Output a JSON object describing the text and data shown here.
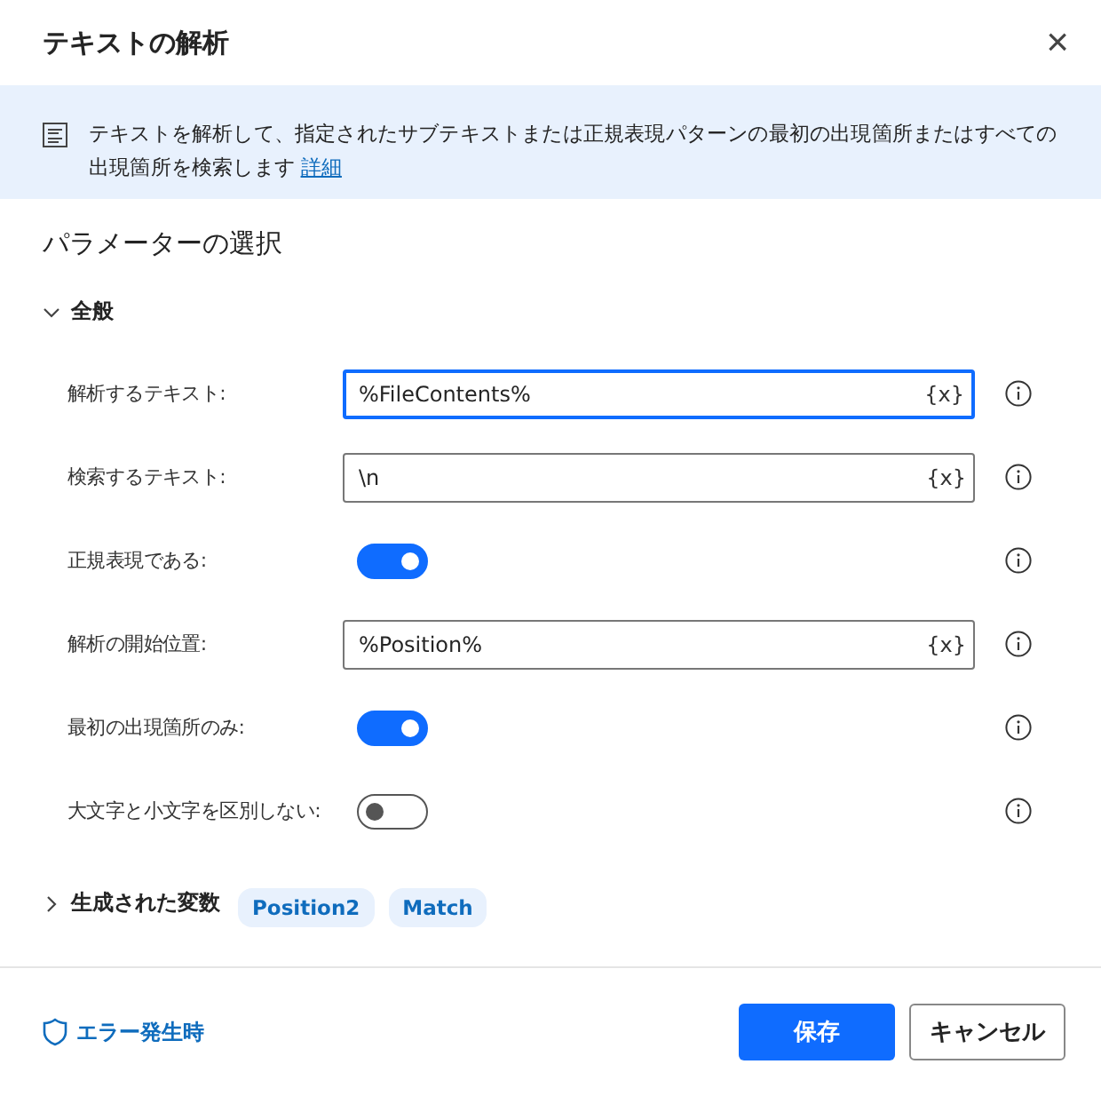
{
  "window": {
    "title": "テキストの解析",
    "close": "×"
  },
  "info": {
    "text": "テキストを解析して、指定されたサブテキストまたは正規表現パターンの最初の出現箇所またはすべての出現箇所を検索します",
    "link": "詳細"
  },
  "section_title": "パラメーターの選択",
  "group": {
    "label": "全般",
    "expanded": true
  },
  "params": [
    {
      "kind": "text",
      "label": "解析するテキスト:",
      "value": "%FileContents%",
      "focused": true,
      "var_button": "{x}"
    },
    {
      "kind": "text",
      "label": "検索するテキスト:",
      "value": "\\n",
      "focused": false,
      "var_button": "{x}"
    },
    {
      "kind": "toggle",
      "label": "正規表現である:",
      "on": true
    },
    {
      "kind": "text",
      "label": "解析の開始位置:",
      "value": "%Position%",
      "focused": false,
      "var_button": "{x}"
    },
    {
      "kind": "toggle",
      "label": "最初の出現箇所のみ:",
      "on": true
    },
    {
      "kind": "toggle",
      "label": "大文字と小文字を区別しない:",
      "on": false
    }
  ],
  "variables": {
    "label": "生成された変数",
    "expanded": false,
    "items": [
      "Position2",
      "Match"
    ]
  },
  "footer": {
    "error_link": "エラー発生時",
    "save": "保存",
    "cancel": "キャンセル"
  }
}
